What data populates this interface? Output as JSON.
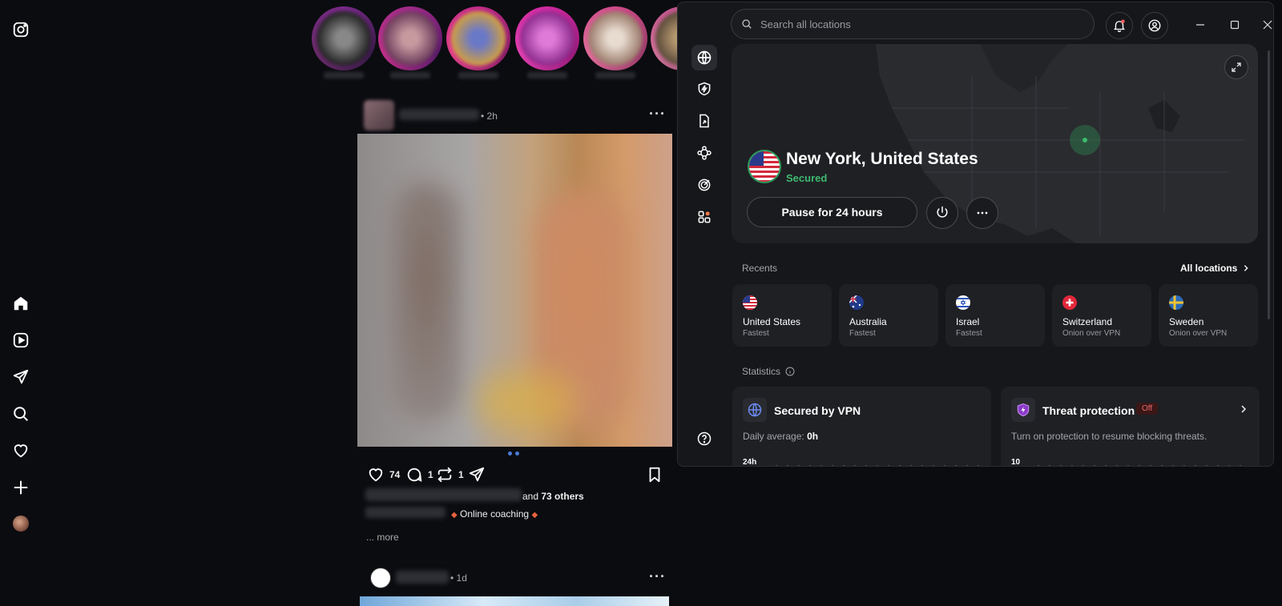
{
  "instagram": {
    "post": {
      "time": "2h",
      "likes": "74",
      "comments": "1",
      "reposts": "1",
      "liked_by_suffix": "and",
      "liked_by_others": "73 others",
      "caption_tag": "Online coaching",
      "more": "... more"
    },
    "post2": {
      "time": "1d"
    }
  },
  "vpn": {
    "search_placeholder": "Search all locations",
    "location": {
      "title": "New York, United States",
      "status": "Secured"
    },
    "pause_label": "Pause for 24 hours",
    "recents_label": "Recents",
    "all_locations_label": "All locations",
    "recents": [
      {
        "name": "United States",
        "sub": "Fastest",
        "flag": "us"
      },
      {
        "name": "Australia",
        "sub": "Fastest",
        "flag": "au"
      },
      {
        "name": "Israel",
        "sub": "Fastest",
        "flag": "il"
      },
      {
        "name": "Switzerland",
        "sub": "Onion over VPN",
        "flag": "ch"
      },
      {
        "name": "Sweden",
        "sub": "Onion over VPN",
        "flag": "se"
      }
    ],
    "statistics_label": "Statistics",
    "stats": {
      "vpn": {
        "title": "Secured by VPN",
        "desc_prefix": "Daily average:",
        "desc_value": "0h",
        "axis_top": "24h"
      },
      "threat": {
        "title": "Threat protection",
        "badge": "Off",
        "desc": "Turn on protection to resume blocking threats.",
        "axis_top": "10"
      }
    },
    "colors": {
      "accent_green": "#3dba6f",
      "badge_red": "#e86a6a",
      "window_bg": "#16171a"
    }
  }
}
